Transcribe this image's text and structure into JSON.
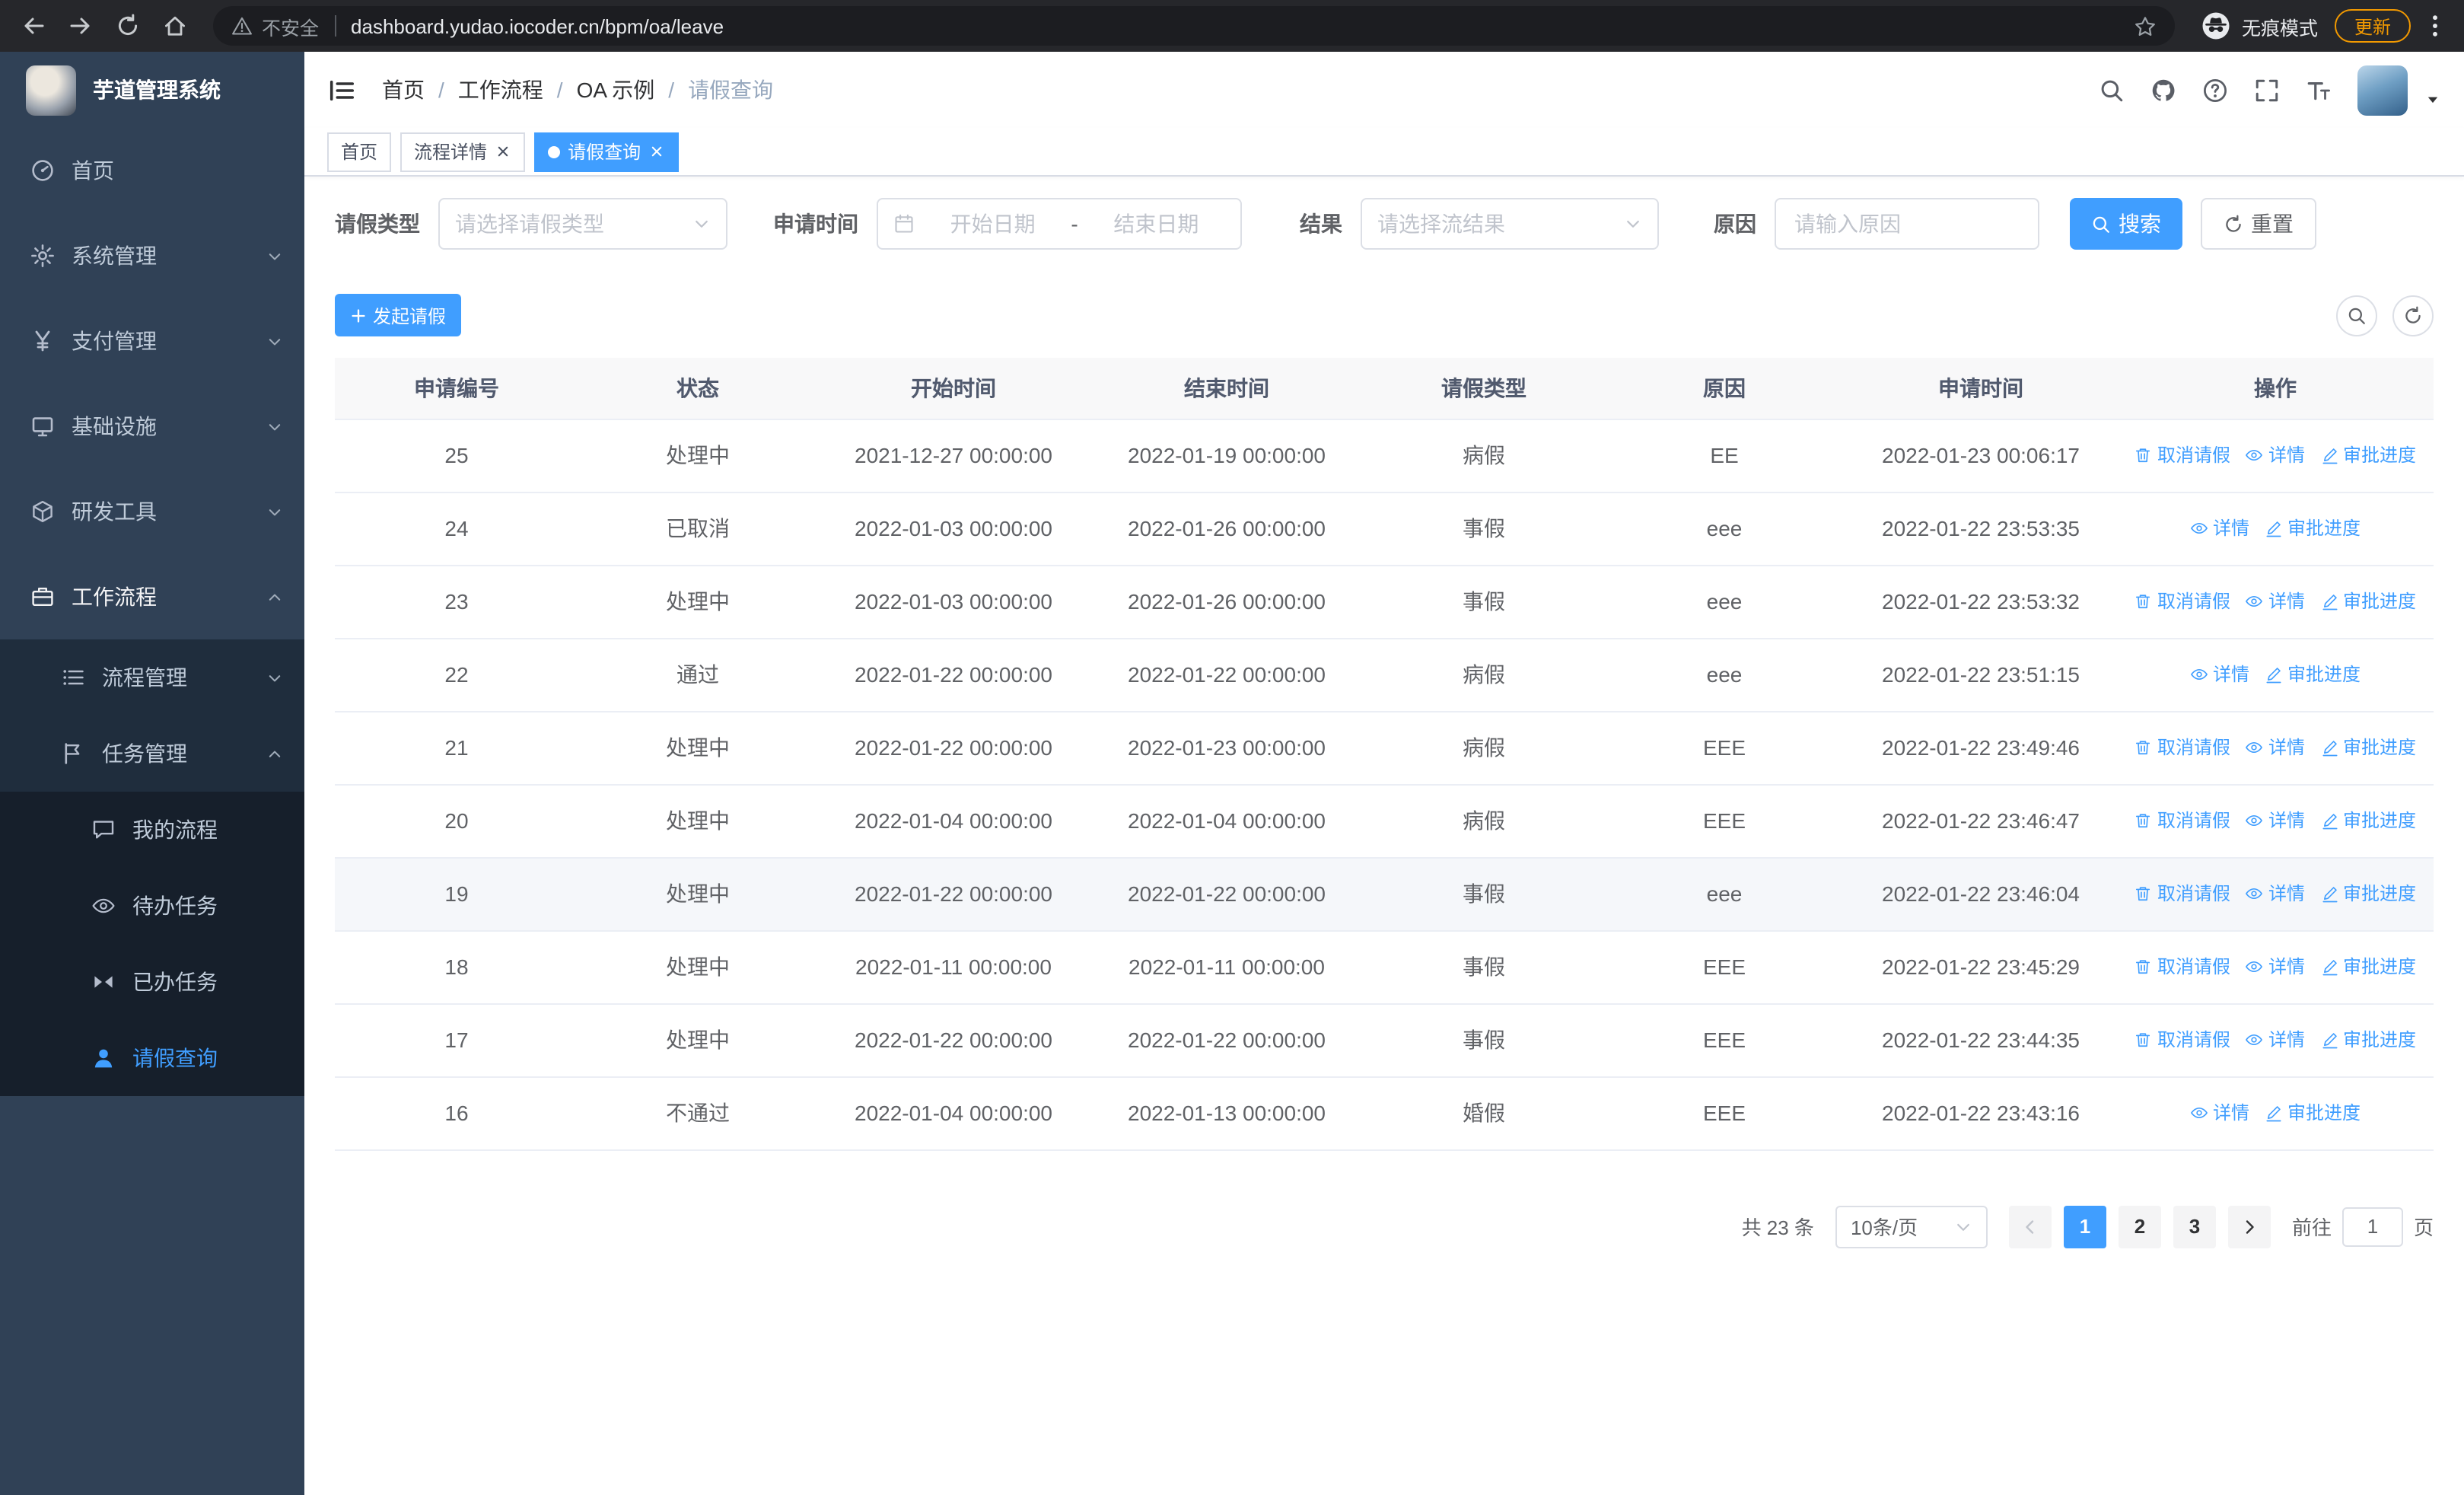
{
  "browser": {
    "url": "dashboard.yudao.iocoder.cn/bpm/oa/leave",
    "security_label": "不安全",
    "incognito_label": "无痕模式",
    "update_label": "更新"
  },
  "sidebar": {
    "logo_title": "芋道管理系统",
    "items": [
      {
        "key": "home",
        "label": "首页",
        "icon": "dashboard-icon",
        "level": 0
      },
      {
        "key": "system-management",
        "label": "系统管理",
        "icon": "gear-icon",
        "level": 0,
        "arrow": "down"
      },
      {
        "key": "payment-management",
        "label": "支付管理",
        "icon": "yen-icon",
        "level": 0,
        "arrow": "down"
      },
      {
        "key": "infrastructure",
        "label": "基础设施",
        "icon": "server-icon",
        "level": 0,
        "arrow": "down"
      },
      {
        "key": "dev-tools",
        "label": "研发工具",
        "icon": "cube-icon",
        "level": 0,
        "arrow": "down"
      },
      {
        "key": "workflow",
        "label": "工作流程",
        "icon": "briefcase-icon",
        "level": 0,
        "arrow": "up",
        "open": true
      },
      {
        "key": "process-management",
        "label": "流程管理",
        "icon": "list-icon",
        "level": 1,
        "arrow": "down"
      },
      {
        "key": "task-management",
        "label": "任务管理",
        "icon": "flag-icon",
        "level": 1,
        "arrow": "up"
      },
      {
        "key": "my-process",
        "label": "我的流程",
        "icon": "chat-icon",
        "level": 2
      },
      {
        "key": "todo-tasks",
        "label": "待办任务",
        "icon": "eye-icon",
        "level": 2
      },
      {
        "key": "done-tasks",
        "label": "已办任务",
        "icon": "bowtie-icon",
        "level": 2
      },
      {
        "key": "leave-query",
        "label": "请假查询",
        "icon": "user-icon",
        "level": 2,
        "active": true
      }
    ]
  },
  "header": {
    "breadcrumb": [
      "首页",
      "工作流程",
      "OA 示例",
      "请假查询"
    ]
  },
  "tabs": [
    {
      "key": "home",
      "label": "首页",
      "closable": false,
      "active": false
    },
    {
      "key": "process-detail",
      "label": "流程详情",
      "closable": true,
      "active": false
    },
    {
      "key": "leave-query",
      "label": "请假查询",
      "closable": true,
      "active": true
    }
  ],
  "filters": {
    "leave_type_label": "请假类型",
    "leave_type_placeholder": "请选择请假类型",
    "apply_time_label": "申请时间",
    "start_date_placeholder": "开始日期",
    "range_separator": "-",
    "end_date_placeholder": "结束日期",
    "result_label": "结果",
    "result_placeholder": "请选择流结果",
    "reason_label": "原因",
    "reason_placeholder": "请输入原因",
    "search_label": "搜索",
    "reset_label": "重置"
  },
  "toolbar": {
    "create_label": "发起请假"
  },
  "table": {
    "columns": [
      "申请编号",
      "状态",
      "开始时间",
      "结束时间",
      "请假类型",
      "原因",
      "申请时间",
      "操作"
    ],
    "action_labels": {
      "cancel": "取消请假",
      "detail": "详情",
      "progress": "审批进度"
    },
    "rows": [
      {
        "id": "25",
        "status": "处理中",
        "start": "2021-12-27 00:00:00",
        "end": "2022-01-19 00:00:00",
        "type": "病假",
        "reason": "EE",
        "applied": "2022-01-23 00:06:17",
        "actions": [
          "cancel",
          "detail",
          "progress"
        ]
      },
      {
        "id": "24",
        "status": "已取消",
        "start": "2022-01-03 00:00:00",
        "end": "2022-01-26 00:00:00",
        "type": "事假",
        "reason": "eee",
        "applied": "2022-01-22 23:53:35",
        "actions": [
          "detail",
          "progress"
        ]
      },
      {
        "id": "23",
        "status": "处理中",
        "start": "2022-01-03 00:00:00",
        "end": "2022-01-26 00:00:00",
        "type": "事假",
        "reason": "eee",
        "applied": "2022-01-22 23:53:32",
        "actions": [
          "cancel",
          "detail",
          "progress"
        ]
      },
      {
        "id": "22",
        "status": "通过",
        "start": "2022-01-22 00:00:00",
        "end": "2022-01-22 00:00:00",
        "type": "病假",
        "reason": "eee",
        "applied": "2022-01-22 23:51:15",
        "actions": [
          "detail",
          "progress"
        ]
      },
      {
        "id": "21",
        "status": "处理中",
        "start": "2022-01-22 00:00:00",
        "end": "2022-01-23 00:00:00",
        "type": "病假",
        "reason": "EEE",
        "applied": "2022-01-22 23:49:46",
        "actions": [
          "cancel",
          "detail",
          "progress"
        ]
      },
      {
        "id": "20",
        "status": "处理中",
        "start": "2022-01-04 00:00:00",
        "end": "2022-01-04 00:00:00",
        "type": "病假",
        "reason": "EEE",
        "applied": "2022-01-22 23:46:47",
        "actions": [
          "cancel",
          "detail",
          "progress"
        ]
      },
      {
        "id": "19",
        "status": "处理中",
        "start": "2022-01-22 00:00:00",
        "end": "2022-01-22 00:00:00",
        "type": "事假",
        "reason": "eee",
        "applied": "2022-01-22 23:46:04",
        "actions": [
          "cancel",
          "detail",
          "progress"
        ],
        "hover": true
      },
      {
        "id": "18",
        "status": "处理中",
        "start": "2022-01-11 00:00:00",
        "end": "2022-01-11 00:00:00",
        "type": "事假",
        "reason": "EEE",
        "applied": "2022-01-22 23:45:29",
        "actions": [
          "cancel",
          "detail",
          "progress"
        ]
      },
      {
        "id": "17",
        "status": "处理中",
        "start": "2022-01-22 00:00:00",
        "end": "2022-01-22 00:00:00",
        "type": "事假",
        "reason": "EEE",
        "applied": "2022-01-22 23:44:35",
        "actions": [
          "cancel",
          "detail",
          "progress"
        ]
      },
      {
        "id": "16",
        "status": "不通过",
        "start": "2022-01-04 00:00:00",
        "end": "2022-01-13 00:00:00",
        "type": "婚假",
        "reason": "EEE",
        "applied": "2022-01-22 23:43:16",
        "actions": [
          "detail",
          "progress"
        ]
      }
    ]
  },
  "pagination": {
    "total_label": "共 23 条",
    "page_size_label": "10条/页",
    "pages": [
      "1",
      "2",
      "3"
    ],
    "active_page": "1",
    "goto_label": "前往",
    "goto_value": "1",
    "page_unit": "页"
  },
  "colors": {
    "accent": "#409EFF",
    "sidebar_bg": "#304156",
    "sidebar_sub_bg": "#1F2D3D",
    "table_header_bg": "#F8F8F9",
    "update_badge": "#F29900"
  }
}
